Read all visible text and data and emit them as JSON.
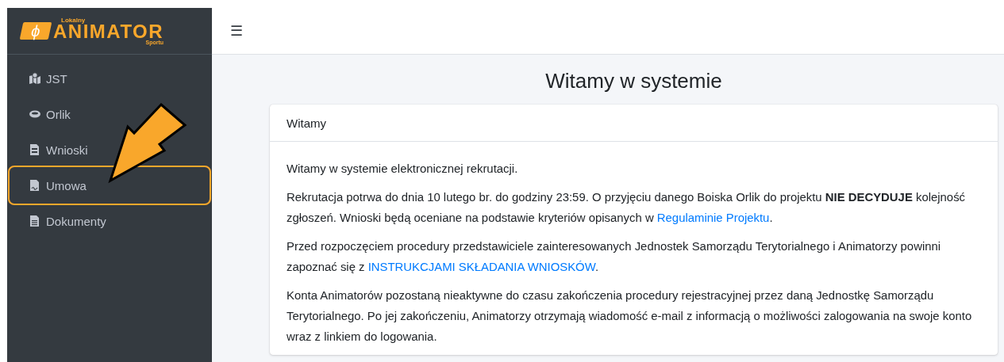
{
  "logo": {
    "mark": "ϕ",
    "top": "Lokalny",
    "main": "ANIMATOR",
    "bottom": "Sportu"
  },
  "sidebar": {
    "items": [
      {
        "label": "JST",
        "kind": "map",
        "highlighted": false
      },
      {
        "label": "Orlik",
        "kind": "ring",
        "highlighted": false
      },
      {
        "label": "Wnioski",
        "kind": "form",
        "highlighted": false
      },
      {
        "label": "Umowa",
        "kind": "contract",
        "highlighted": true
      },
      {
        "label": "Dokumenty",
        "kind": "doc",
        "highlighted": false
      }
    ]
  },
  "header": {
    "menu_icon": "☰"
  },
  "page_title": "Witamy w systemie",
  "card": {
    "title": "Witamy",
    "paragraphs": [
      [
        {
          "kind": "text",
          "text": "Witamy w systemie elektronicznej rekrutacji."
        }
      ],
      [
        {
          "kind": "text",
          "text": "Rekrutacja potrwa do dnia 10 lutego br. do godziny 23:59. O przyjęciu danego Boiska Orlik do projektu **NIE DECYDUJE** kolejność zgłoszeń. Wnioski będą oceniane na podstawie kryteriów opisanych w "
        },
        {
          "kind": "link",
          "text": "Regulaminie Projektu"
        },
        {
          "kind": "text",
          "text": "."
        }
      ],
      [
        {
          "kind": "text",
          "text": "Przed rozpoczęciem procedury przedstawiciele zainteresowanych Jednostek Samorządu Terytorialnego i Animatorzy powinni zapoznać się z "
        },
        {
          "kind": "link",
          "text": "INSTRUKCJAMI SKŁADANIA WNIOSKÓW"
        },
        {
          "kind": "text",
          "text": "."
        }
      ],
      [
        {
          "kind": "text",
          "text": "Konta Animatorów pozostaną nieaktywne do czasu zakończenia procedury rejestracyjnej przez daną Jednostkę Samorządu Terytorialnego. Po jej zakończeniu, Animatorzy otrzymają wiadomość e-mail z informacją o możliwości zalogowania na swoje konto wraz z linkiem do logowania."
        }
      ]
    ]
  },
  "callout": {
    "kind": "arrow",
    "color": "#f9a72b"
  }
}
